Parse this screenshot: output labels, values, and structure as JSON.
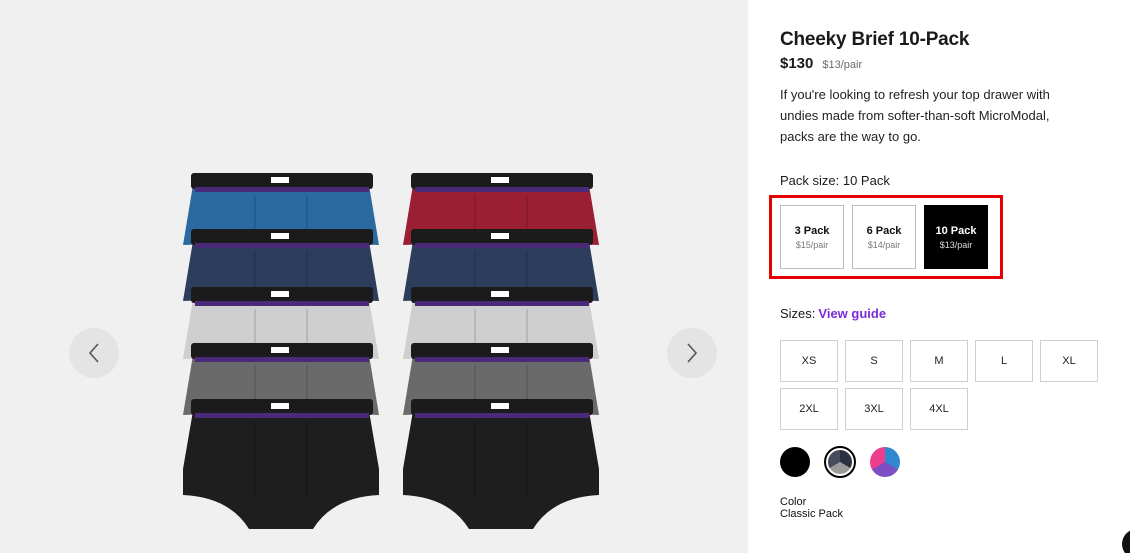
{
  "product": {
    "title": "Cheeky Brief 10-Pack",
    "price": "$130",
    "per_pair": "$13/pair",
    "description": "If you're looking to refresh your top drawer with undies made from softer-than-soft MicroModal, packs are the way to go."
  },
  "pack": {
    "label": "Pack size: 10 Pack",
    "options": [
      {
        "name": "3 Pack",
        "price": "$15/pair"
      },
      {
        "name": "6 Pack",
        "price": "$14/pair"
      },
      {
        "name": "10 Pack",
        "price": "$13/pair"
      }
    ],
    "selected": "10 Pack"
  },
  "sizes": {
    "label": "Sizes:",
    "guide_link": "View guide",
    "options": [
      "XS",
      "S",
      "M",
      "L",
      "XL",
      "2XL",
      "3XL",
      "4XL"
    ]
  },
  "swatches": [
    {
      "icon": "black-swatch",
      "colors": [
        "#000000"
      ]
    },
    {
      "icon": "classic-pack-swatch",
      "colors": [
        "#2c3140",
        "#9a9a9a",
        "#474d5e"
      ]
    },
    {
      "icon": "bright-pack-swatch",
      "colors": [
        "#2f88d0",
        "#7d4fc4",
        "#ee3d8a"
      ]
    }
  ],
  "color": {
    "label": "Color",
    "value": "Classic Pack"
  },
  "gallery": {
    "prev_icon": "chevron-left-icon",
    "next_icon": "chevron-right-icon",
    "brief_colors_left": [
      "#2a6aa0",
      "#2c3e5c",
      "#cfcfcf",
      "#6a6a6a",
      "#1e1e1e"
    ],
    "brief_colors_right": [
      "#9b1f33",
      "#2c3e5c",
      "#cfcfcf",
      "#6a6a6a",
      "#1e1e1e"
    ]
  },
  "colors": {
    "accent_link": "#7b2cd9",
    "highlight_box": "#e60000",
    "selected_pack": "#000000"
  }
}
